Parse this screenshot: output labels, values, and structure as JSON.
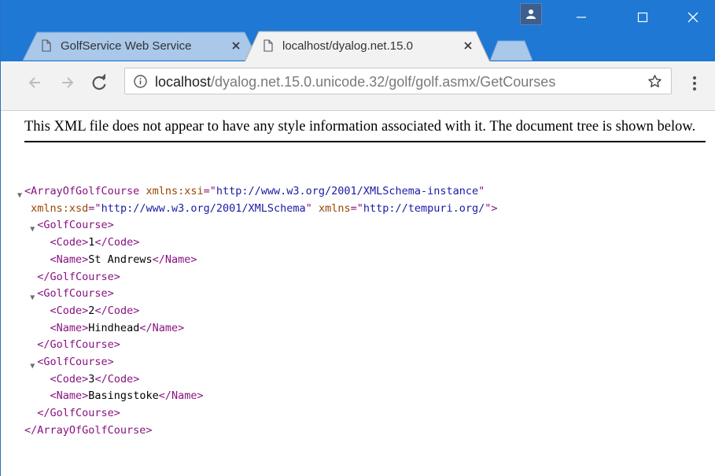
{
  "browser": {
    "tabs": [
      {
        "title": "GolfService Web Service",
        "active": false
      },
      {
        "title": "localhost/dyalog.net.15.0",
        "active": true
      }
    ],
    "address": {
      "host": "localhost",
      "path": "/dyalog.net.15.0.unicode.32/golf/golf.asmx/GetCourses"
    }
  },
  "page": {
    "notice": "This XML file does not appear to have any style information associated with it. The document tree is shown below."
  },
  "xml": {
    "root_tag": "ArrayOfGolfCourse",
    "root_attrs": [
      {
        "name": "xmlns:xsi",
        "value": "http://www.w3.org/2001/XMLSchema-instance"
      },
      {
        "name": "xmlns:xsd",
        "value": "http://www.w3.org/2001/XMLSchema"
      },
      {
        "name": "xmlns",
        "value": "http://tempuri.org/"
      }
    ],
    "item_tag": "GolfCourse",
    "fields": [
      "Code",
      "Name"
    ],
    "courses": [
      {
        "Code": "1",
        "Name": "St Andrews"
      },
      {
        "Code": "2",
        "Name": "Hindhead"
      },
      {
        "Code": "3",
        "Name": "Basingstoke"
      }
    ]
  },
  "colors": {
    "titlebar": "#1e78d4",
    "tag": "#881280",
    "attribute_name": "#994500",
    "attribute_value": "#1a1aa6"
  }
}
